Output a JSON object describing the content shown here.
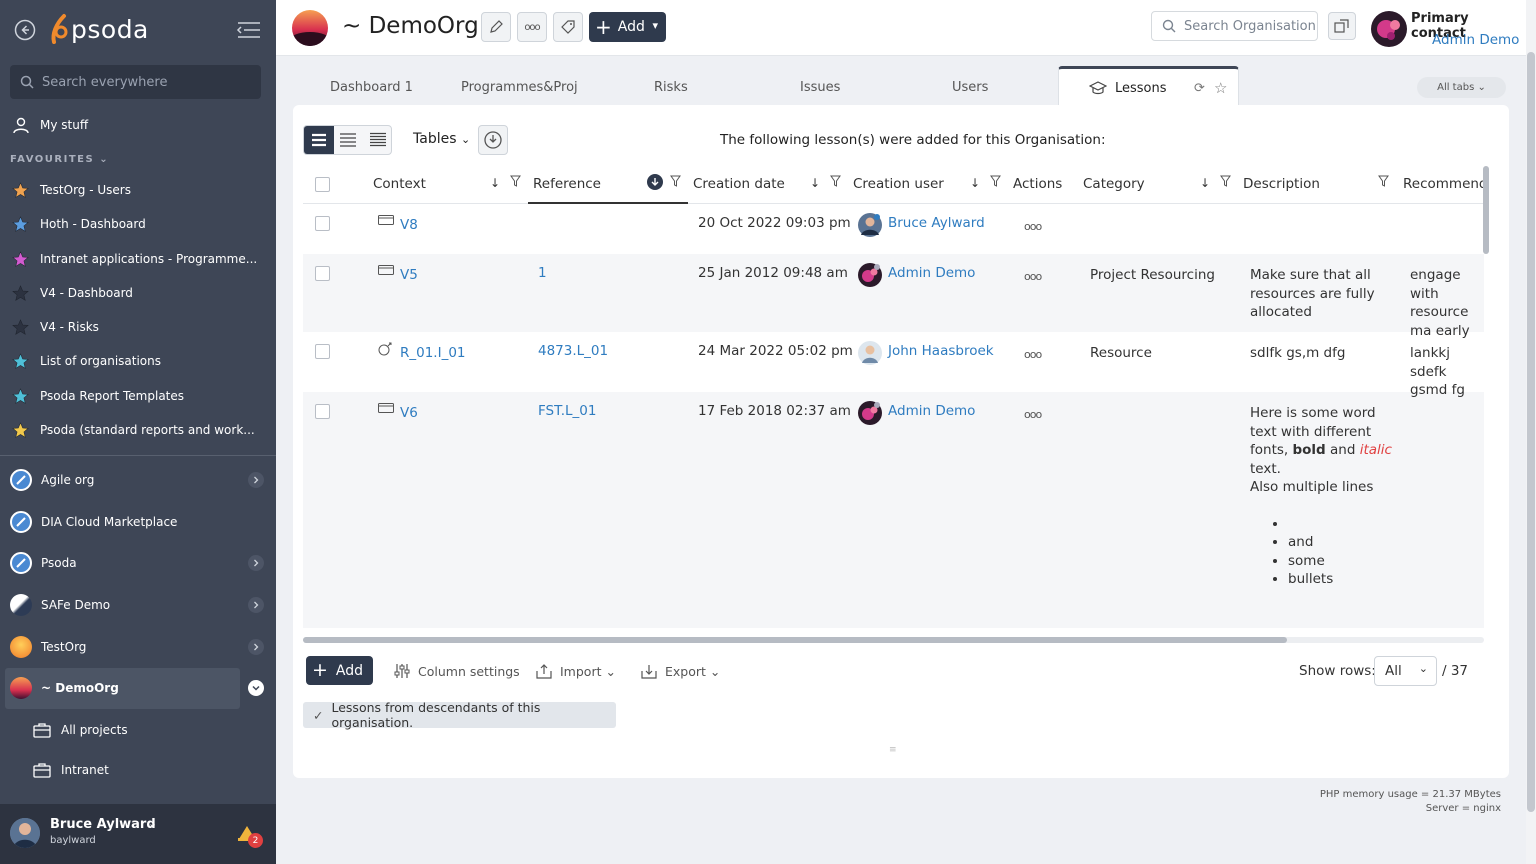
{
  "sidebar": {
    "logo_text": "psoda",
    "search_placeholder": "Search everywhere",
    "my_stuff": "My stuff",
    "favourites_heading": "FAVOURITES",
    "favourites": [
      {
        "label": "TestOrg - Users",
        "color": "#f0a350"
      },
      {
        "label": "Hoth - Dashboard",
        "color": "#5b9de0"
      },
      {
        "label": "Intranet applications - Programme...",
        "color": "#d25bd0"
      },
      {
        "label": "V4 - Dashboard",
        "color": "#2c3240"
      },
      {
        "label": "V4 - Risks",
        "color": "#2c3240"
      },
      {
        "label": "List of organisations",
        "color": "#4fc0d8"
      },
      {
        "label": "Psoda Report Templates",
        "color": "#4fc0d8"
      },
      {
        "label": "Psoda (standard reports and work...",
        "color": "#f2c94c"
      }
    ],
    "orgs": [
      {
        "label": "Agile org"
      },
      {
        "label": "DIA Cloud Marketplace"
      },
      {
        "label": "Psoda"
      },
      {
        "label": "SAFe Demo"
      },
      {
        "label": "TestOrg"
      },
      {
        "label": "~ DemoOrg"
      }
    ],
    "sub_items": [
      {
        "label": "All projects"
      },
      {
        "label": "Intranet"
      }
    ],
    "user_name": "Bruce Aylward",
    "user_login": "baylward",
    "notification_count": "2"
  },
  "header": {
    "org_title": "~ DemoOrg",
    "add_label": "Add",
    "search_placeholder": "Search Organisation",
    "primary_contact_label": "Primary contact",
    "primary_contact_name": "Admin Demo"
  },
  "tabs": {
    "items": [
      "Dashboard 1",
      "Programmes&Proj",
      "Risks",
      "Issues",
      "Users",
      "Lessons"
    ],
    "all_tabs_label": "All tabs"
  },
  "toolbar": {
    "tables_label": "Tables",
    "caption": "The following lesson(s) were added for this Organisation:"
  },
  "table": {
    "columns": [
      "Context",
      "Reference",
      "Creation date",
      "Creation user",
      "Actions",
      "Category",
      "Description",
      "Recommend"
    ],
    "rows": [
      {
        "context": "V8",
        "reference": "",
        "date": "20 Oct 2022 09:03 pm",
        "user": "Bruce Aylward",
        "category": "",
        "description": "",
        "recommend": ""
      },
      {
        "context": "V5",
        "reference": "1",
        "date": "25 Jan 2012 09:48 am",
        "user": "Admin Demo",
        "category": "Project Resourcing",
        "description": "Make sure that all resources are fully allocated",
        "recommend": "engage with resource ma early"
      },
      {
        "context": "R_01.I_01",
        "reference": "4873.L_01",
        "date": "24 Mar 2022 05:02 pm",
        "user": "John Haasbroek",
        "category": "Resource",
        "description": "sdlfk gs,m dfg",
        "recommend": "lankkj sdefk gsmd fg"
      },
      {
        "context": "V6",
        "reference": "FST.L_01",
        "date": "17 Feb 2018 02:37 am",
        "user": "Admin Demo",
        "category": "",
        "description": "",
        "recommend": ""
      }
    ],
    "rich_description": {
      "line1": "Here is some word",
      "line2": "text with different",
      "line3_a": "fonts, ",
      "line3_bold": "bold",
      "line3_b": " and ",
      "line3_italic": "italic",
      "line4": "text.",
      "line5": "Also multiple lines",
      "bullets": [
        "",
        "and",
        "some",
        "bullets"
      ]
    }
  },
  "table_footer": {
    "add_label": "Add",
    "column_settings": "Column settings",
    "import": "Import",
    "export": "Export",
    "show_rows_label": "Show rows:",
    "show_rows_value": "All",
    "total": "/ 37",
    "descendants_label": "Lessons from descendants of this organisation."
  },
  "footer": {
    "memory": "PHP memory usage = 21.37 MBytes",
    "server": "Server = nginx"
  },
  "colors": {
    "sidebar_bg": "#3e4656",
    "accent_dark": "#2f3a4d",
    "link": "#2f7cc0"
  }
}
